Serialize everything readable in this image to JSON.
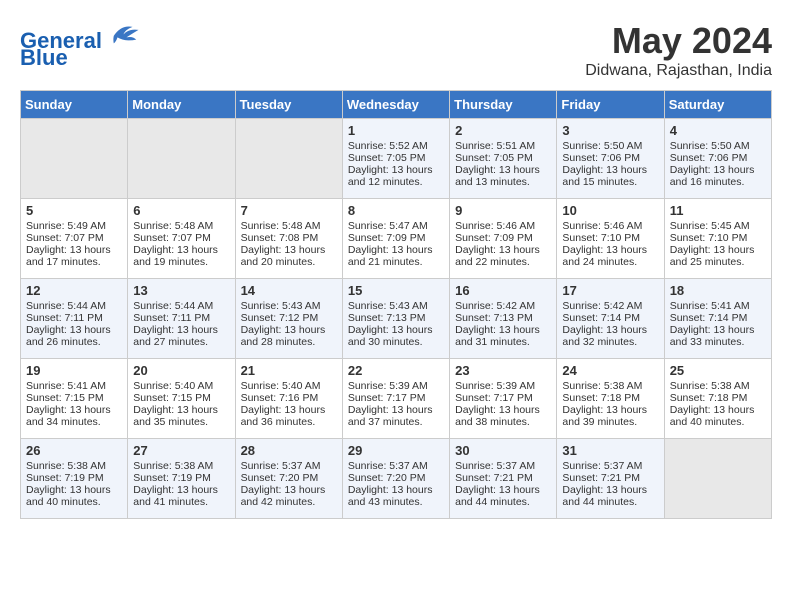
{
  "header": {
    "logo_line1": "General",
    "logo_line2": "Blue",
    "month": "May 2024",
    "location": "Didwana, Rajasthan, India"
  },
  "days_of_week": [
    "Sunday",
    "Monday",
    "Tuesday",
    "Wednesday",
    "Thursday",
    "Friday",
    "Saturday"
  ],
  "weeks": [
    [
      {
        "day": "",
        "info": ""
      },
      {
        "day": "",
        "info": ""
      },
      {
        "day": "",
        "info": ""
      },
      {
        "day": "1",
        "info": "Sunrise: 5:52 AM\nSunset: 7:05 PM\nDaylight: 13 hours and 12 minutes."
      },
      {
        "day": "2",
        "info": "Sunrise: 5:51 AM\nSunset: 7:05 PM\nDaylight: 13 hours and 13 minutes."
      },
      {
        "day": "3",
        "info": "Sunrise: 5:50 AM\nSunset: 7:06 PM\nDaylight: 13 hours and 15 minutes."
      },
      {
        "day": "4",
        "info": "Sunrise: 5:50 AM\nSunset: 7:06 PM\nDaylight: 13 hours and 16 minutes."
      }
    ],
    [
      {
        "day": "5",
        "info": "Sunrise: 5:49 AM\nSunset: 7:07 PM\nDaylight: 13 hours and 17 minutes."
      },
      {
        "day": "6",
        "info": "Sunrise: 5:48 AM\nSunset: 7:07 PM\nDaylight: 13 hours and 19 minutes."
      },
      {
        "day": "7",
        "info": "Sunrise: 5:48 AM\nSunset: 7:08 PM\nDaylight: 13 hours and 20 minutes."
      },
      {
        "day": "8",
        "info": "Sunrise: 5:47 AM\nSunset: 7:09 PM\nDaylight: 13 hours and 21 minutes."
      },
      {
        "day": "9",
        "info": "Sunrise: 5:46 AM\nSunset: 7:09 PM\nDaylight: 13 hours and 22 minutes."
      },
      {
        "day": "10",
        "info": "Sunrise: 5:46 AM\nSunset: 7:10 PM\nDaylight: 13 hours and 24 minutes."
      },
      {
        "day": "11",
        "info": "Sunrise: 5:45 AM\nSunset: 7:10 PM\nDaylight: 13 hours and 25 minutes."
      }
    ],
    [
      {
        "day": "12",
        "info": "Sunrise: 5:44 AM\nSunset: 7:11 PM\nDaylight: 13 hours and 26 minutes."
      },
      {
        "day": "13",
        "info": "Sunrise: 5:44 AM\nSunset: 7:11 PM\nDaylight: 13 hours and 27 minutes."
      },
      {
        "day": "14",
        "info": "Sunrise: 5:43 AM\nSunset: 7:12 PM\nDaylight: 13 hours and 28 minutes."
      },
      {
        "day": "15",
        "info": "Sunrise: 5:43 AM\nSunset: 7:13 PM\nDaylight: 13 hours and 30 minutes."
      },
      {
        "day": "16",
        "info": "Sunrise: 5:42 AM\nSunset: 7:13 PM\nDaylight: 13 hours and 31 minutes."
      },
      {
        "day": "17",
        "info": "Sunrise: 5:42 AM\nSunset: 7:14 PM\nDaylight: 13 hours and 32 minutes."
      },
      {
        "day": "18",
        "info": "Sunrise: 5:41 AM\nSunset: 7:14 PM\nDaylight: 13 hours and 33 minutes."
      }
    ],
    [
      {
        "day": "19",
        "info": "Sunrise: 5:41 AM\nSunset: 7:15 PM\nDaylight: 13 hours and 34 minutes."
      },
      {
        "day": "20",
        "info": "Sunrise: 5:40 AM\nSunset: 7:15 PM\nDaylight: 13 hours and 35 minutes."
      },
      {
        "day": "21",
        "info": "Sunrise: 5:40 AM\nSunset: 7:16 PM\nDaylight: 13 hours and 36 minutes."
      },
      {
        "day": "22",
        "info": "Sunrise: 5:39 AM\nSunset: 7:17 PM\nDaylight: 13 hours and 37 minutes."
      },
      {
        "day": "23",
        "info": "Sunrise: 5:39 AM\nSunset: 7:17 PM\nDaylight: 13 hours and 38 minutes."
      },
      {
        "day": "24",
        "info": "Sunrise: 5:38 AM\nSunset: 7:18 PM\nDaylight: 13 hours and 39 minutes."
      },
      {
        "day": "25",
        "info": "Sunrise: 5:38 AM\nSunset: 7:18 PM\nDaylight: 13 hours and 40 minutes."
      }
    ],
    [
      {
        "day": "26",
        "info": "Sunrise: 5:38 AM\nSunset: 7:19 PM\nDaylight: 13 hours and 40 minutes."
      },
      {
        "day": "27",
        "info": "Sunrise: 5:38 AM\nSunset: 7:19 PM\nDaylight: 13 hours and 41 minutes."
      },
      {
        "day": "28",
        "info": "Sunrise: 5:37 AM\nSunset: 7:20 PM\nDaylight: 13 hours and 42 minutes."
      },
      {
        "day": "29",
        "info": "Sunrise: 5:37 AM\nSunset: 7:20 PM\nDaylight: 13 hours and 43 minutes."
      },
      {
        "day": "30",
        "info": "Sunrise: 5:37 AM\nSunset: 7:21 PM\nDaylight: 13 hours and 44 minutes."
      },
      {
        "day": "31",
        "info": "Sunrise: 5:37 AM\nSunset: 7:21 PM\nDaylight: 13 hours and 44 minutes."
      },
      {
        "day": "",
        "info": ""
      }
    ]
  ]
}
